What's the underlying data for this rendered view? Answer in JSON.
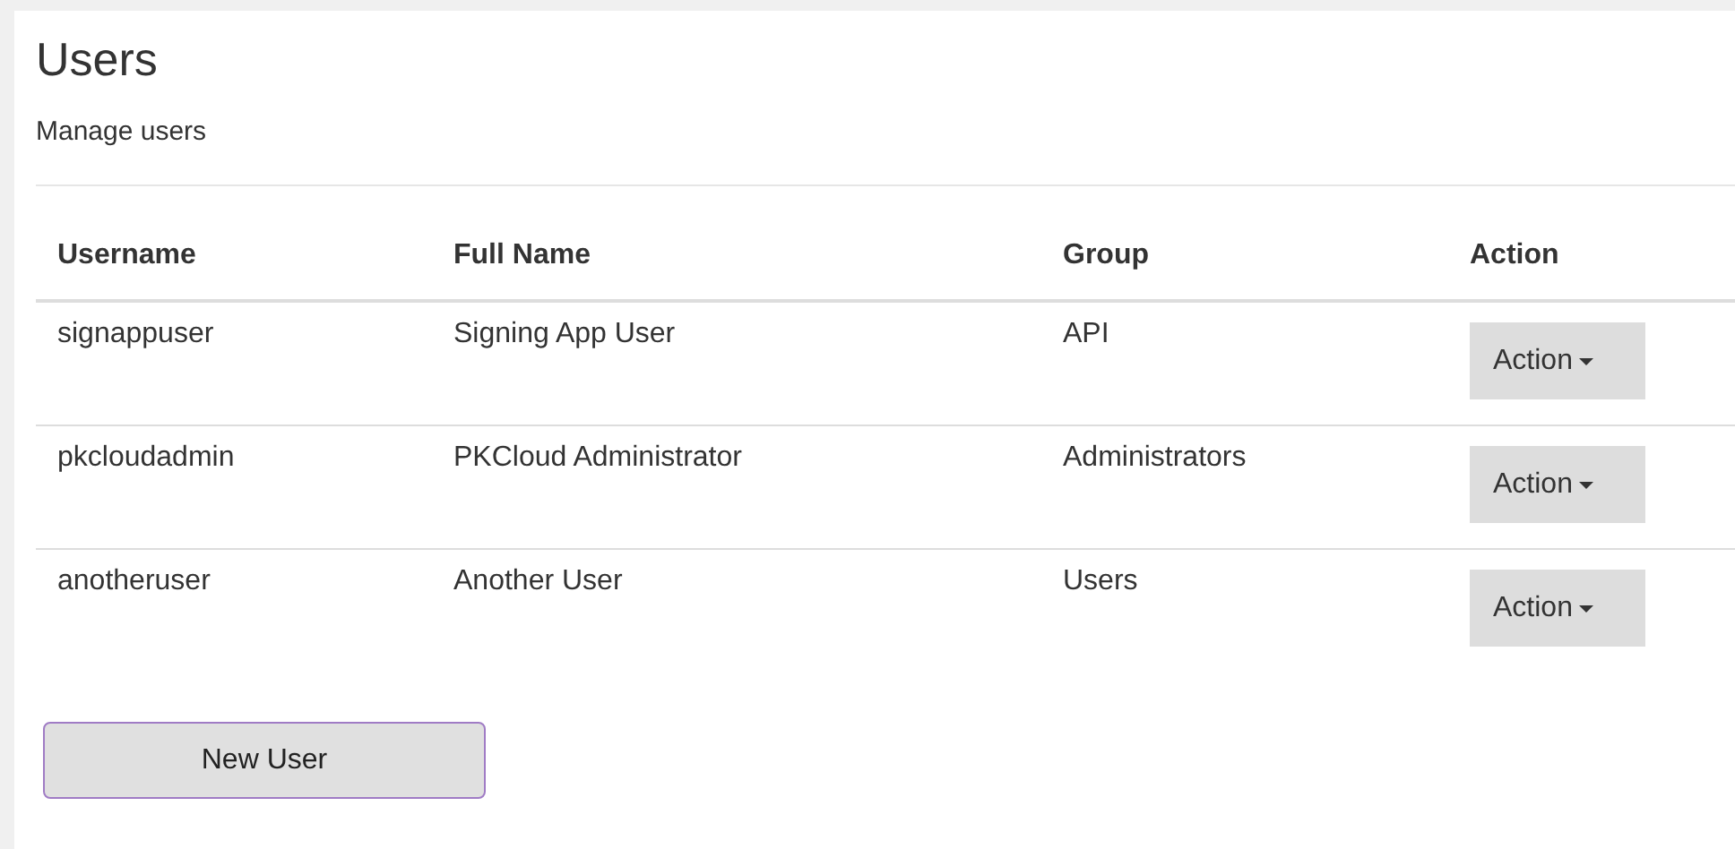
{
  "title": "Users",
  "subtitle": "Manage users",
  "table": {
    "columns": [
      "Username",
      "Full Name",
      "Group",
      "Action"
    ],
    "rows": [
      {
        "username": "signappuser",
        "full_name": "Signing App User",
        "group": "API",
        "action": "Action"
      },
      {
        "username": "pkcloudadmin",
        "full_name": "PKCloud Administrator",
        "group": "Administrators",
        "action": "Action"
      },
      {
        "username": "anotheruser",
        "full_name": "Another User",
        "group": "Users",
        "action": "Action"
      }
    ]
  },
  "new_button": "New User"
}
